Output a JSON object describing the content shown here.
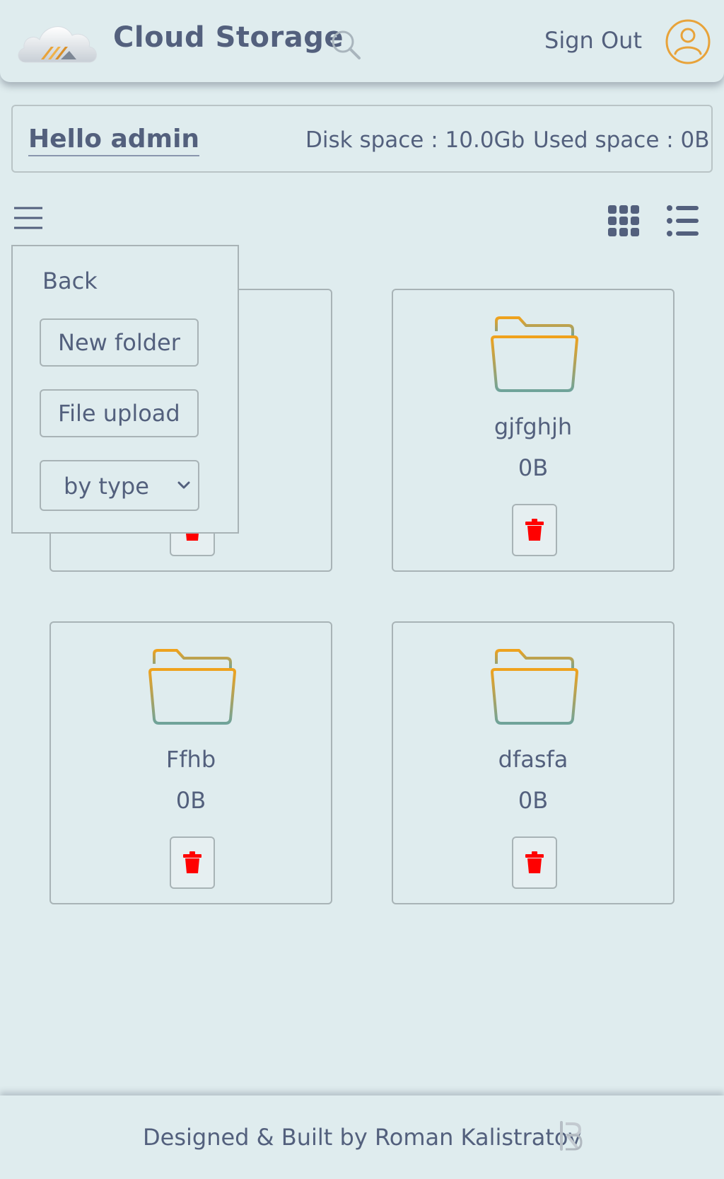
{
  "header": {
    "title": "Cloud Storage",
    "sign_out_label": "Sign Out",
    "logo_icon": "cloud-logo-icon",
    "search_icon": "search-icon",
    "avatar_icon": "user-avatar-icon",
    "accent_color": "#e8a33a",
    "text_color": "#53607d"
  },
  "info_bar": {
    "greeting": "Hello admin",
    "disk_space": "Disk space : 10.0Gb",
    "used_space": "Used space : 0B"
  },
  "toolbar": {
    "menu_icon": "hamburger-menu-icon",
    "grid_view_icon": "grid-view-icon",
    "list_view_icon": "list-view-icon"
  },
  "menu": {
    "back_label": "Back",
    "new_folder_label": "New folder",
    "file_upload_label": "File upload",
    "sort_selected": "by type"
  },
  "files": [
    {
      "name": "",
      "size": ""
    },
    {
      "name": "gjfghjh",
      "size": "0B"
    },
    {
      "name": "Ffhb",
      "size": "0B"
    },
    {
      "name": "dfasfa",
      "size": "0B"
    }
  ],
  "delete_color": "#ff0000",
  "footer": {
    "credit": "Designed & Built by Roman Kalistratov"
  }
}
